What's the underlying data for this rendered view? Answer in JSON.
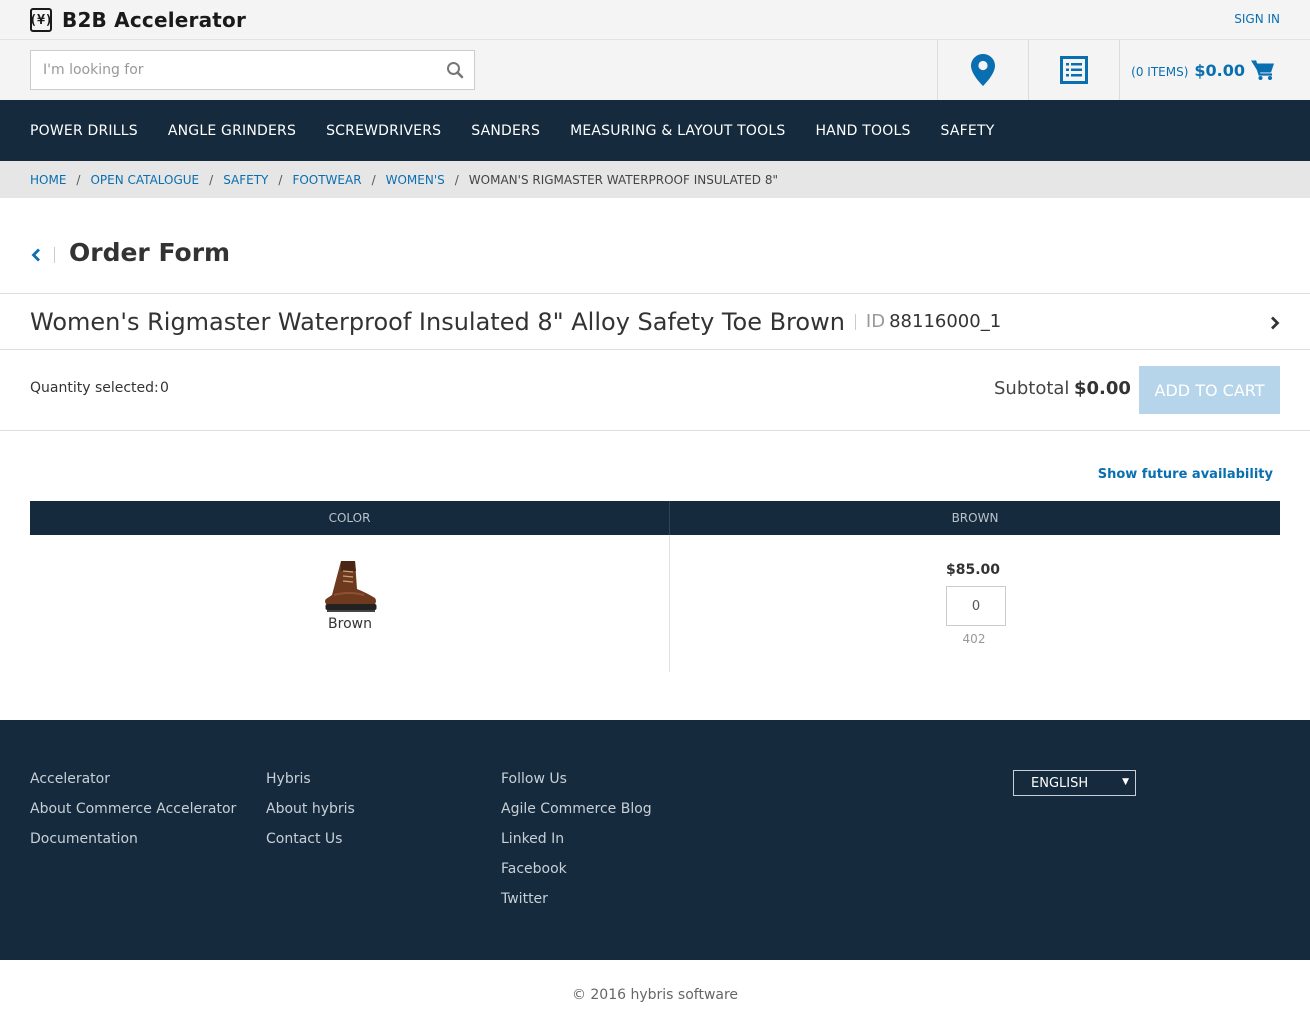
{
  "header": {
    "logo_text": "B2B Accelerator",
    "logo_mark": "(¥)",
    "sign_in": "SIGN IN",
    "search_placeholder": "I'm looking for",
    "cart_items": "(0 ITEMS)",
    "cart_total": "$0.00"
  },
  "nav": {
    "items": [
      "POWER DRILLS",
      "ANGLE GRINDERS",
      "SCREWDRIVERS",
      "SANDERS",
      "MEASURING & LAYOUT TOOLS",
      "HAND TOOLS",
      "SAFETY"
    ]
  },
  "breadcrumb": {
    "items": [
      "HOME",
      "OPEN CATALOGUE",
      "SAFETY",
      "FOOTWEAR",
      "WOMEN'S"
    ],
    "separator": "/",
    "current": "WOMAN'S RIGMASTER WATERPROOF INSULATED 8\""
  },
  "page": {
    "title": "Order Form"
  },
  "product": {
    "name": "Women's Rigmaster Waterproof Insulated 8\" Alloy Safety Toe Brown",
    "id_label": "ID",
    "id": "88116000_1"
  },
  "order": {
    "quantity_label": "Quantity selected:",
    "quantity_value": "0",
    "subtotal_label": "Subtotal",
    "subtotal_value": "$0.00",
    "add_to_cart": "ADD TO CART",
    "future_availability": "Show future availability"
  },
  "grid": {
    "col_color": "COLOR",
    "col_variant": "BROWN",
    "swatch_label": "Brown",
    "price": "$85.00",
    "qty_value": "0",
    "stock": "402"
  },
  "footer": {
    "col1": [
      "Accelerator",
      "About Commerce Accelerator",
      "Documentation"
    ],
    "col2": [
      "Hybris",
      "About hybris",
      "Contact Us"
    ],
    "col3": [
      "Follow Us",
      "Agile Commerce Blog",
      "Linked In",
      "Facebook",
      "Twitter"
    ],
    "language": "ENGLISH",
    "copyright": "© 2016 hybris software"
  },
  "colors": {
    "navy": "#152a3c",
    "link_blue": "#0a6fb1",
    "button_disabled": "#b7d5ea"
  }
}
